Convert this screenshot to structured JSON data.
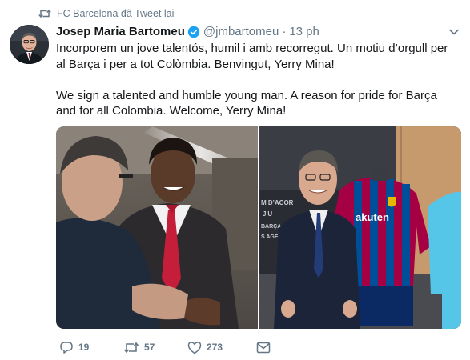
{
  "retweet": {
    "label": "FC Barcelona đã Tweet lại",
    "icon": "retweet-icon"
  },
  "author": {
    "display_name": "Josep Maria Bartomeu",
    "verified": true,
    "handle": "@jmbartomeu",
    "separator": "·",
    "time": "13 ph"
  },
  "tweet": {
    "text_catalan": "Incorporem un jove talentós, humil i amb recorregut. Un motiu d’orgull per al Barça i per a tot Colòmbia. Benvingut, Yerry Mina!",
    "text_english": "We sign a talented and humble young man. A reason for pride for Barça and for all Colombia. Welcome, Yerry Mina!"
  },
  "media": {
    "left_photo_alt": "",
    "right_photo_alt": "",
    "backdrop_text": [
      "M D’ACOR",
      "J'U",
      "BARÇA",
      "S AGF"
    ],
    "kit_sponsor": "akuten"
  },
  "actions": {
    "replies": "19",
    "retweets": "57",
    "likes": "273"
  },
  "colors": {
    "text": "#14171a",
    "secondary": "#657786",
    "verified": "#1da1f2"
  }
}
